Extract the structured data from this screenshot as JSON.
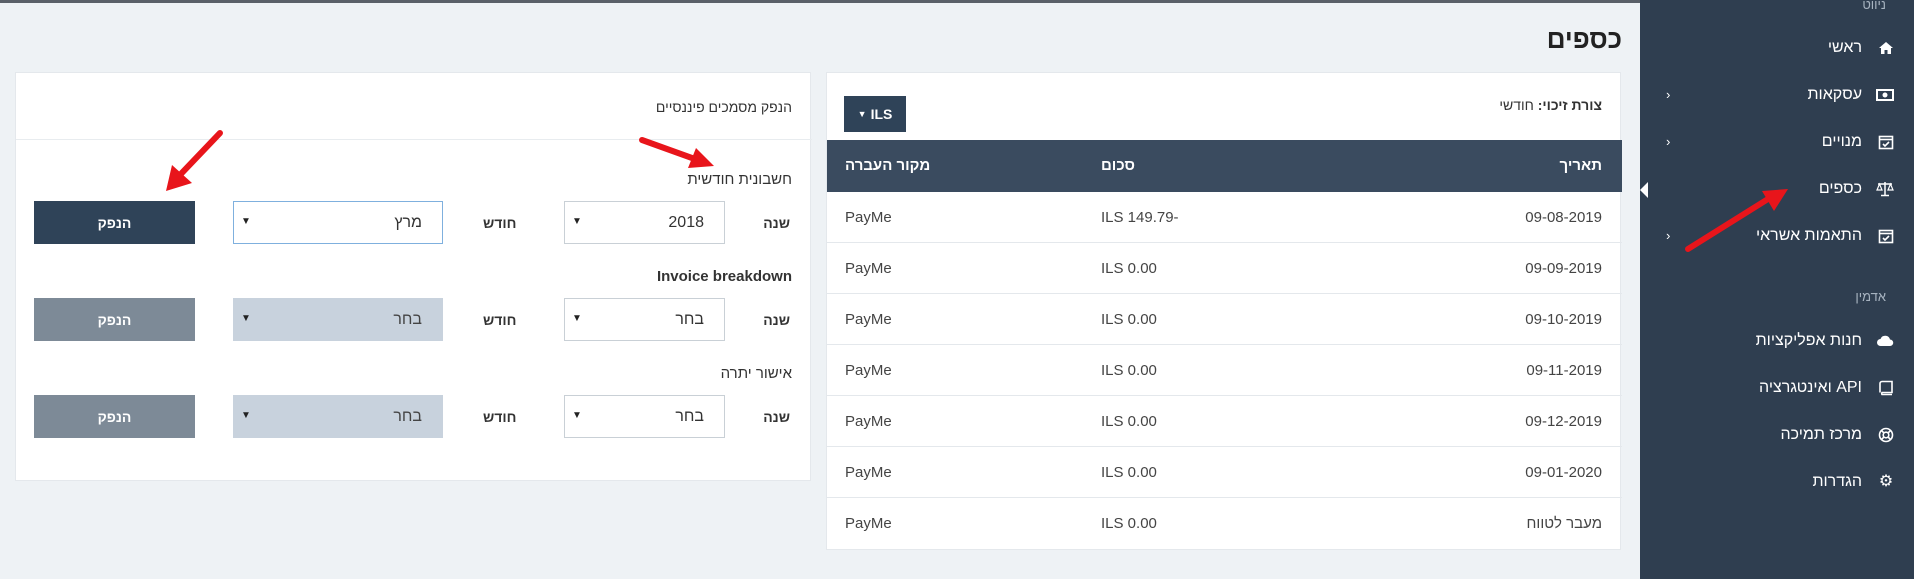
{
  "page": {
    "title": "כספים"
  },
  "sidebar": {
    "section_nav": "ניווט",
    "section_admin": "אדמין",
    "items": [
      {
        "label": "ראשי",
        "icon": "home-icon",
        "chevron": ""
      },
      {
        "label": "עסקאות",
        "icon": "money-icon",
        "chevron": "›"
      },
      {
        "label": "מנויים",
        "icon": "calendar-check-icon",
        "chevron": "›"
      },
      {
        "label": "כספים",
        "icon": "scale-icon",
        "chevron": ""
      },
      {
        "label": "התאמות אשראי",
        "icon": "calendar-check-icon",
        "chevron": "›"
      },
      {
        "label": "חנות אפליקציות",
        "icon": "cloud-icon",
        "chevron": ""
      },
      {
        "label": "API ואינטגרציה",
        "icon": "book-icon",
        "chevron": ""
      },
      {
        "label": "מרכז תמיכה",
        "icon": "lifebuoy-icon",
        "chevron": ""
      },
      {
        "label": "הגדרות",
        "icon": "gear-icon",
        "chevron": ""
      }
    ]
  },
  "payouts": {
    "credit_form_label": "צורת זיכוי:",
    "credit_form_value": "חודשי",
    "currency_button": "ILS",
    "columns": {
      "date": "תאריך",
      "amount": "סכום",
      "source": "מקור העברה"
    },
    "rows": [
      {
        "date": "09-08-2019",
        "amount": "ILS 149.79-",
        "source": "PayMe"
      },
      {
        "date": "09-09-2019",
        "amount": "ILS 0.00",
        "source": "PayMe"
      },
      {
        "date": "09-10-2019",
        "amount": "ILS 0.00",
        "source": "PayMe"
      },
      {
        "date": "09-11-2019",
        "amount": "ILS 0.00",
        "source": "PayMe"
      },
      {
        "date": "09-12-2019",
        "amount": "ILS 0.00",
        "source": "PayMe"
      },
      {
        "date": "09-01-2020",
        "amount": "ILS 0.00",
        "source": "PayMe"
      },
      {
        "date": "מעבר לטווח",
        "amount": "ILS 0.00",
        "source": "PayMe"
      }
    ]
  },
  "issue_docs": {
    "title": "הנפק מסמכים פיננסיים",
    "year_label": "שנה",
    "month_label": "חודש",
    "sections": [
      {
        "title": "חשבונית חודשית",
        "year": "2018",
        "month": "מרץ",
        "button": "הנפק"
      },
      {
        "title": "Invoice breakdown",
        "year": "בחר",
        "month": "בחר",
        "button": "הנפק"
      },
      {
        "title": "אישור יתרה",
        "year": "בחר",
        "month": "בחר",
        "button": "הנפק"
      }
    ]
  },
  "colors": {
    "sidebar_bg": "#2f3e50",
    "primary": "#2f4358",
    "arrow": "#e8151b"
  }
}
